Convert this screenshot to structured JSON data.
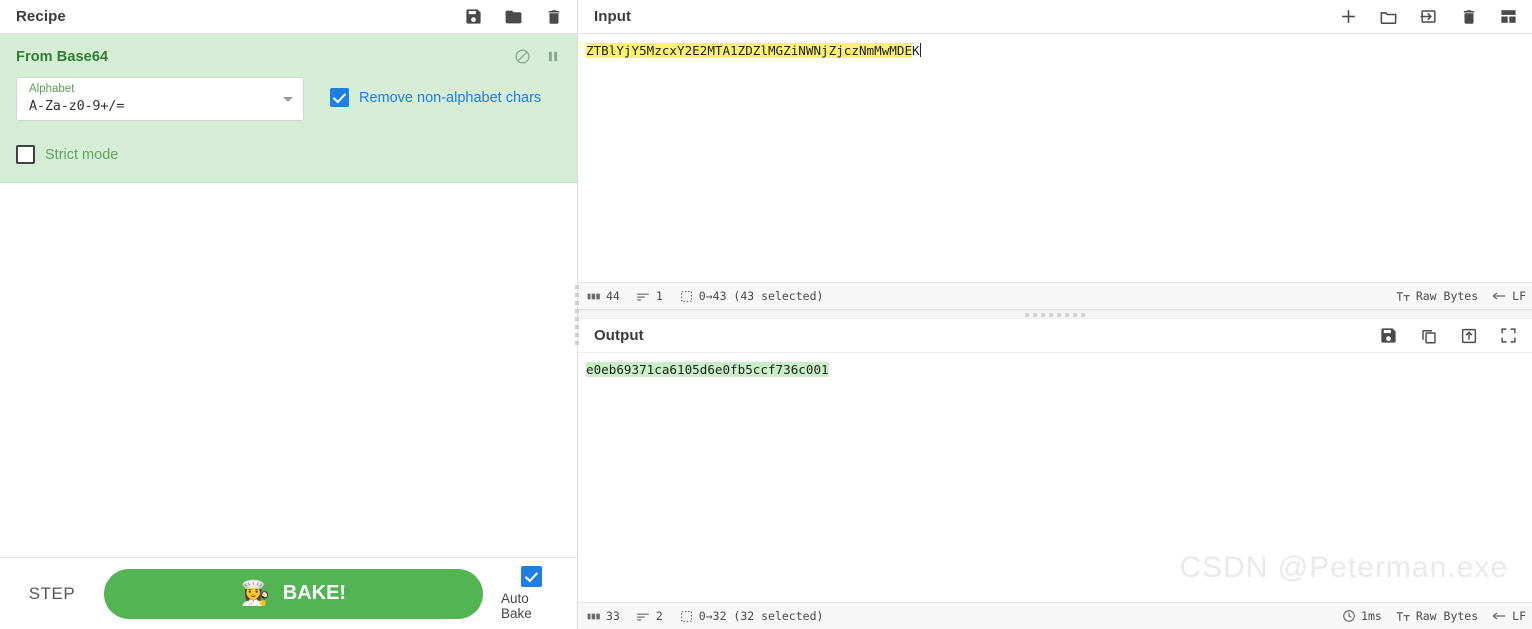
{
  "recipe": {
    "title": "Recipe",
    "icons": [
      {
        "name": "save-recipe-icon",
        "glyph": "save"
      },
      {
        "name": "load-recipe-icon",
        "glyph": "folder"
      },
      {
        "name": "clear-recipe-icon",
        "glyph": "trash"
      }
    ],
    "operation": {
      "name": "From Base64",
      "disable_icon": "disable-operation-icon",
      "breakpoint_icon": "pause-breakpoint-icon",
      "alphabet_label": "Alphabet",
      "alphabet_value": "A-Za-z0-9+/=",
      "remove_non_alphabet_label": "Remove non-alphabet chars",
      "remove_non_alphabet_checked": true,
      "strict_mode_label": "Strict mode",
      "strict_mode_checked": false
    },
    "step_label": "STEP",
    "bake_label": "BAKE!",
    "bake_emoji": "👩‍🍳",
    "auto_bake_label": "Auto Bake",
    "auto_bake_checked": true,
    "accent_green": "#53b453",
    "op_bg_green": "#d5ecd5",
    "checkbox_blue": "#1d7fe0"
  },
  "input": {
    "title": "Input",
    "icons": [
      {
        "name": "add-input-tab-icon",
        "glyph": "plus"
      },
      {
        "name": "open-file-icon",
        "glyph": "folder"
      },
      {
        "name": "open-folder-as-input-icon",
        "glyph": "import"
      },
      {
        "name": "clear-io-icon",
        "glyph": "trash"
      },
      {
        "name": "reset-pane-layout-icon",
        "glyph": "layout"
      }
    ],
    "text_selected": "ZTBlYjY5MzcxY2E2MTA1ZDZlMGZiNWNjZjczNmMwMDE",
    "text_unselected": "K",
    "status": {
      "length_icon": "character-count-icon",
      "length": "44",
      "lines_icon": "line-count-icon",
      "lines": "1",
      "selection_icon": "selection-icon",
      "selection": "0→43 (43 selected)",
      "encoding_icon": "character-encoding-icon",
      "encoding": "Raw Bytes",
      "eol_icon": "line-ending-icon",
      "eol": "LF"
    },
    "selection_color": "#fbf36e"
  },
  "output": {
    "title": "Output",
    "icons": [
      {
        "name": "save-output-icon",
        "glyph": "save"
      },
      {
        "name": "copy-output-icon",
        "glyph": "copy"
      },
      {
        "name": "replace-input-with-output-icon",
        "glyph": "replace"
      },
      {
        "name": "maximise-output-icon",
        "glyph": "maximise"
      }
    ],
    "text": "e0eb69371ca6105d6e0fb5ccf736c001",
    "status": {
      "length_icon": "character-count-icon",
      "length": "33",
      "lines_icon": "line-count-icon",
      "lines": "2",
      "selection_icon": "selection-icon",
      "selection": "0→32 (32 selected)",
      "time_icon": "bake-time-icon",
      "time": "1ms",
      "encoding_icon": "character-encoding-icon",
      "encoding": "Raw Bytes",
      "eol_icon": "line-ending-icon",
      "eol": "LF"
    },
    "selection_color": "#c9efc9"
  },
  "watermark": "CSDN @Peterman.exe"
}
